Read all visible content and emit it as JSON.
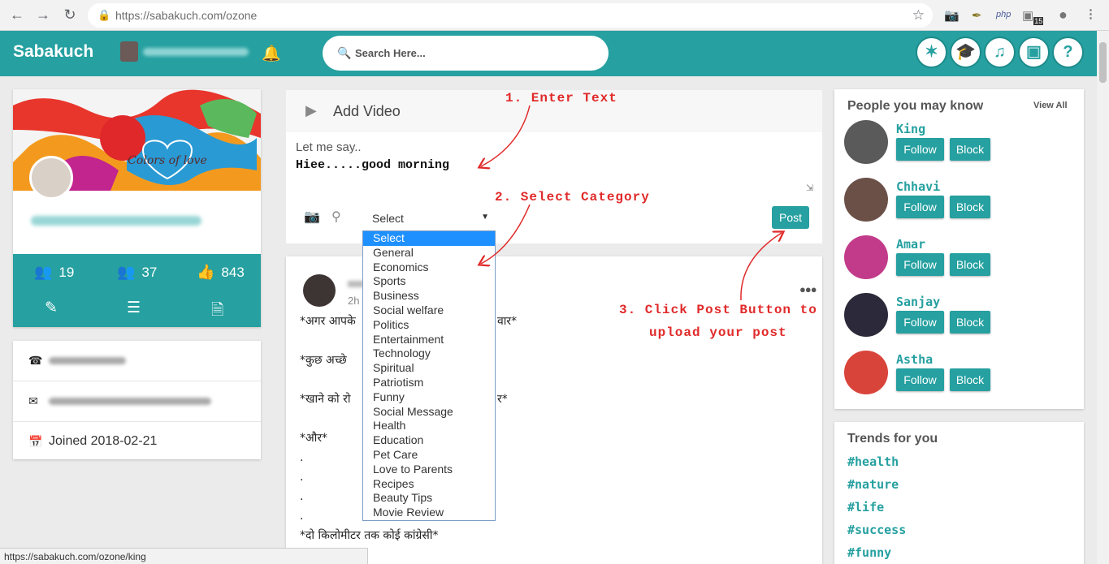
{
  "browser": {
    "url_host": "https://sabakuch.com",
    "url_path": "/ozone",
    "status_url": "https://sabakuch.com/ozone/king",
    "extension_badge": "15",
    "php_label": "php"
  },
  "header": {
    "logo": "Sabakuch",
    "search_placeholder": "Search Here..."
  },
  "profile": {
    "stats": [
      {
        "icon": "friends-icon",
        "value": "19"
      },
      {
        "icon": "followers-icon",
        "value": "37"
      },
      {
        "icon": "thumbs-up-icon",
        "value": "843"
      }
    ],
    "joined": "Joined 2018-02-21",
    "cover_text": "Colors of love"
  },
  "composer": {
    "tab_label": "Add Video",
    "placeholder": "Let me say..",
    "typed_text": "Hiee.....good morning",
    "select_value": "Select",
    "post_label": "Post"
  },
  "category_options": [
    "Select",
    "General",
    "Economics",
    "Sports",
    "Business",
    "Social welfare",
    "Politics",
    "Entertainment",
    "Technology",
    "Spiritual",
    "Patriotism",
    "Funny",
    "Social Message",
    "Health",
    "Education",
    "Pet Care",
    "Love to Parents",
    "Recipes",
    "Beauty Tips",
    "Movie Review"
  ],
  "feed_post": {
    "time": "2h",
    "lines": [
      "*अगर आपके",
      "वार*",
      "*कुछ अच्छे",
      "*खाने को रो",
      "र*",
      "*और*",
      ".",
      ".",
      ".",
      ".",
      "*दो किलोमीटर तक कोई कांग्रेसी*"
    ]
  },
  "annotations": {
    "step1": "1. Enter Text",
    "step2": "2. Select Category",
    "step3_line1": "3. Click Post Button to",
    "step3_line2": "upload your post"
  },
  "people": {
    "title": "People you may know",
    "view_all": "View All",
    "follow_label": "Follow",
    "block_label": "Block",
    "items": [
      {
        "name": "King",
        "color": "#5a5a5a"
      },
      {
        "name": "Chhavi",
        "color": "#6b5048"
      },
      {
        "name": "Amar",
        "color": "#c23b8a"
      },
      {
        "name": "Sanjay",
        "color": "#2c2a3a"
      },
      {
        "name": "Astha",
        "color": "#d9443a"
      }
    ]
  },
  "trends": {
    "title": "Trends for you",
    "items": [
      "#health",
      "#nature",
      "#life",
      "#success",
      "#funny"
    ]
  },
  "colors": {
    "brand": "#26a0a0",
    "annotation": "#e12a2a"
  }
}
